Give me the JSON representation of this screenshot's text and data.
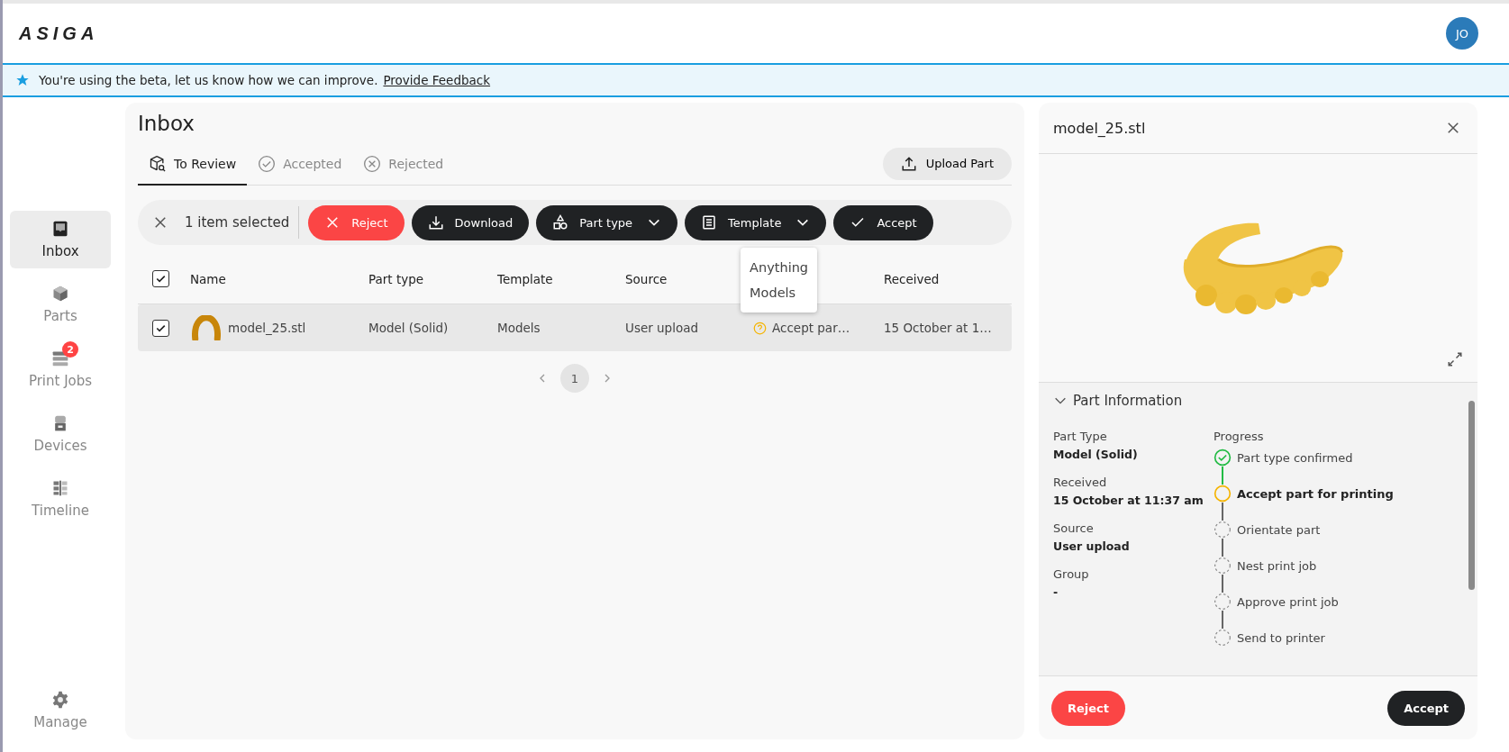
{
  "header": {
    "logo": "ASIGA",
    "avatar": "JO"
  },
  "banner": {
    "text": "You're using the beta, let us know how we can improve.",
    "link": "Provide Feedback"
  },
  "sidebar": {
    "items": [
      {
        "label": "Inbox",
        "selected": true
      },
      {
        "label": "Parts",
        "selected": false
      },
      {
        "label": "Print Jobs",
        "selected": false,
        "badge": "2"
      },
      {
        "label": "Devices",
        "selected": false
      },
      {
        "label": "Timeline",
        "selected": false
      }
    ],
    "footer_item": {
      "label": "Manage"
    }
  },
  "inbox": {
    "title": "Inbox",
    "tabs": [
      {
        "label": "To Review",
        "selected": true
      },
      {
        "label": "Accepted",
        "selected": false
      },
      {
        "label": "Rejected",
        "selected": false
      }
    ],
    "upload_button": "Upload Part",
    "selection_bar": {
      "count_text": "1 item selected",
      "actions": [
        {
          "label": "Reject",
          "kind": "danger"
        },
        {
          "label": "Download",
          "kind": "dark"
        },
        {
          "label": "Part type",
          "kind": "dropdown"
        },
        {
          "label": "Template",
          "kind": "dropdown"
        },
        {
          "label": "Accept",
          "kind": "dark"
        }
      ]
    },
    "template_menu": {
      "items": [
        "Anything",
        "Models"
      ]
    },
    "table": {
      "all_selected": true,
      "columns": [
        "Name",
        "Part type",
        "Template",
        "Source",
        "Received"
      ],
      "rows": [
        {
          "name": "model_25.stl",
          "part_type": "Model (Solid)",
          "template": "Models",
          "source": "User upload",
          "status": "Accept par…",
          "received": "15 October at 1…",
          "selected": true
        }
      ]
    },
    "pagination": {
      "pages": [
        {
          "label": "1",
          "selected": true
        }
      ]
    }
  },
  "detail": {
    "title": "model_25.stl",
    "section": {
      "title": "Part Information",
      "expanded": true
    },
    "fields": [
      {
        "label": "Part Type",
        "value": "Model (Solid)"
      },
      {
        "label": "Received",
        "value": "15 October at 11:37 am"
      },
      {
        "label": "Source",
        "value": "User upload"
      },
      {
        "label": "Group",
        "value": "-"
      }
    ],
    "progress": {
      "title": "Progress",
      "steps": [
        {
          "label": "Part type confirmed",
          "completed": true,
          "active": false
        },
        {
          "label": "Accept part for printing",
          "completed": false,
          "active": true
        },
        {
          "label": "Orientate part",
          "completed": false,
          "active": false
        },
        {
          "label": "Nest print job",
          "completed": false,
          "active": false
        },
        {
          "label": "Approve print job",
          "completed": false,
          "active": false
        },
        {
          "label": "Send to printer",
          "completed": false,
          "active": false
        }
      ]
    },
    "buttons": [
      {
        "label": "Reject",
        "kind": "danger"
      },
      {
        "label": "Accept",
        "kind": "dark"
      }
    ]
  }
}
